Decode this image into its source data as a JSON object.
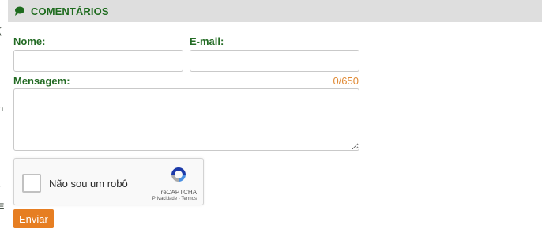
{
  "section": {
    "title": "COMENTÁRIOS",
    "icon": "chat-bubble-icon",
    "accent_color": "#1e6b1e",
    "header_bg": "#dedede"
  },
  "form": {
    "name_label": "Nome:",
    "email_label": "E-mail:",
    "message_label": "Mensagem:",
    "counter": "0/650",
    "name_value": "",
    "email_value": "",
    "message_value": ""
  },
  "captcha": {
    "label": "Não sou um robô",
    "brand": "reCAPTCHA",
    "links": "Privacidade - Termos",
    "icon": "recaptcha-logo-icon"
  },
  "submit": {
    "label": "Enviar",
    "color": "#e67e22"
  },
  "edge_fragments": [
    ":",
    "(",
    "n",
    "r",
    "E"
  ]
}
